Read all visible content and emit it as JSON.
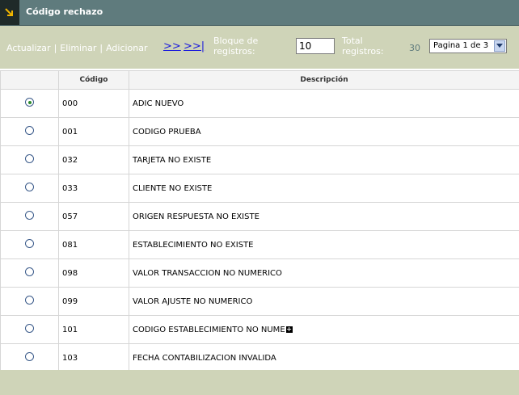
{
  "window": {
    "title": "Código rechazo"
  },
  "toolbar": {
    "actions": [
      "Actualizar",
      "Eliminar",
      "Adicionar"
    ],
    "next_label": ">>",
    "last_label": ">>|",
    "block_label_1": "Bloque de",
    "block_label_2": "registros:",
    "block_value": "10",
    "total_label_1": "Total",
    "total_label_2": "registros:",
    "total_value": "30",
    "page_select": "Pagina 1 de 3"
  },
  "table": {
    "headers": [
      "",
      "Código",
      "Descripción"
    ],
    "rows": [
      {
        "selected": true,
        "codigo": "000",
        "descripcion": "ADIC NUEVO"
      },
      {
        "selected": false,
        "codigo": "001",
        "descripcion": "CODIGO PRUEBA"
      },
      {
        "selected": false,
        "codigo": "032",
        "descripcion": "TARJETA NO EXISTE"
      },
      {
        "selected": false,
        "codigo": "033",
        "descripcion": "CLIENTE NO EXISTE"
      },
      {
        "selected": false,
        "codigo": "057",
        "descripcion": "ORIGEN RESPUESTA NO EXISTE"
      },
      {
        "selected": false,
        "codigo": "081",
        "descripcion": "ESTABLECIMIENTO NO EXISTE"
      },
      {
        "selected": false,
        "codigo": "098",
        "descripcion": "VALOR TRANSACCION NO NUMERICO"
      },
      {
        "selected": false,
        "codigo": "099",
        "descripcion": "VALOR AJUSTE NO NUMERICO"
      },
      {
        "selected": false,
        "codigo": "101",
        "descripcion": "CODIGO ESTABLECIMIENTO NO NUME",
        "expand": true
      },
      {
        "selected": false,
        "codigo": "103",
        "descripcion": "FECHA CONTABILIZACION INVALIDA"
      }
    ]
  },
  "colors": {
    "titlebar": "#5f7b7d",
    "toolbar": "#cfd4b8",
    "link": "#1a1adc"
  },
  "icons": {
    "title": "arrow-down-right-icon",
    "expand": "plus-icon",
    "dropdown": "chevron-down-icon"
  }
}
